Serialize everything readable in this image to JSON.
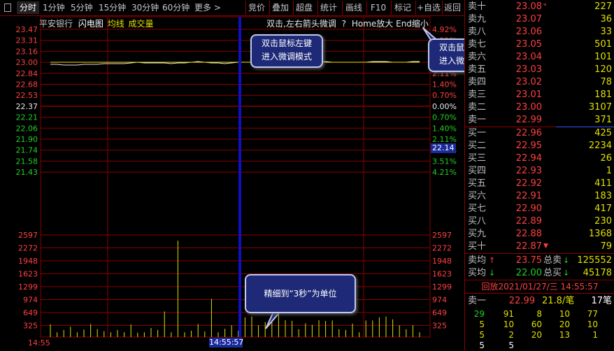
{
  "toolbar": {
    "items": [
      "分时",
      "1分钟",
      "5分钟",
      "15分钟",
      "30分钟",
      "60分钟",
      "更多 >",
      "竞价",
      "叠加",
      "超盘",
      "统计",
      "画线",
      "F10",
      "标记",
      "+自选",
      "返回"
    ]
  },
  "chart": {
    "stock_name": "平安银行",
    "mode_flash": "闪电图",
    "mode_avg": "均线",
    "mode_vol": "成交量",
    "hint": "双击,左右箭头微调",
    "hint_q": "?",
    "hint2": "Home放大 End缩小",
    "price_labels": [
      "23.47",
      "23.31",
      "23.16",
      "23.00",
      "22.84",
      "22.68",
      "22.53",
      "22.37",
      "22.21",
      "22.06",
      "21.90",
      "21.74",
      "21.58",
      "21.43"
    ],
    "pct_labels": [
      "4.92%",
      "4.21%",
      "3.51%",
      "2.81%",
      "2.11%",
      "1.40%",
      "0.70%",
      "0.00%",
      "0.70%",
      "1.40%",
      "2.11%",
      "2.81%",
      "3.51%",
      "4.21%"
    ],
    "vol_labels": [
      "2597",
      "2272",
      "1948",
      "1623",
      "1299",
      "974",
      "649",
      "325"
    ],
    "current_price_tag": "22.14",
    "time_start": "14:55",
    "time_cursor": "14:55:57",
    "tips": {
      "tip1_line1": "双击鼠标左键",
      "tip1_line2": "进入微调模式",
      "tip2_line1": "双击鼠标左键",
      "tip2_line2": "进入微调模式",
      "tip3": "精细到“3秒”为单位"
    },
    "colors": {
      "grid": "#8a0000",
      "price_line": "#e8e8e8",
      "avg_line": "#e0e000",
      "cursor": "#1010c0"
    }
  },
  "chart_data": {
    "type": "line",
    "series": [
      {
        "values": [
          22.97,
          22.97,
          22.96,
          22.96,
          22.96,
          22.97,
          22.97,
          22.97,
          22.98,
          22.98,
          22.98,
          22.98,
          22.99,
          23.0,
          22.99,
          22.99,
          22.99,
          22.99,
          22.98,
          22.99,
          22.99,
          23.0,
          23.01,
          23.0,
          22.99,
          22.99,
          22.98,
          22.99,
          23.0,
          23.0,
          23.0,
          23.01,
          23.01,
          23.0,
          23.0,
          23.01,
          23.01,
          23.0,
          23.0,
          23.0,
          23.01,
          23.01,
          23.0,
          23.0,
          23.0,
          23.0,
          23.0,
          23.0,
          23.01,
          23.01,
          23.01,
          23.0,
          23.0,
          23.0,
          23.01,
          23.01
        ]
      },
      {
        "values": [
          23.0,
          23.0,
          23.0,
          23.0,
          23.0,
          23.0,
          23.0,
          23.0,
          23.0,
          23.0,
          23.0,
          23.0,
          23.0,
          23.0,
          23.0,
          23.0,
          23.0,
          23.0,
          23.0,
          23.0,
          23.0,
          23.0,
          23.0,
          23.0,
          23.0,
          23.0,
          23.0,
          23.0,
          23.0,
          23.0,
          23.0,
          23.0,
          23.0,
          23.0,
          23.0,
          23.0,
          23.0,
          23.0,
          23.0,
          23.0,
          23.0,
          23.0,
          23.0,
          23.0,
          23.0,
          23.0,
          23.0,
          23.0,
          23.0,
          23.0,
          23.0,
          23.0,
          23.0,
          23.0,
          23.0,
          23.0
        ]
      }
    ],
    "volume_values": [
      325,
      120,
      180,
      260,
      120,
      190,
      330,
      200,
      150,
      120,
      180,
      120,
      320,
      110,
      120,
      230,
      180,
      650,
      120,
      2450,
      120,
      160,
      330,
      140,
      970,
      120,
      210,
      300,
      160,
      500,
      520,
      300,
      380,
      560,
      600,
      430,
      410,
      200,
      350,
      310,
      430,
      410,
      420,
      200,
      180,
      340,
      120,
      420,
      420,
      500,
      520,
      450,
      300,
      200,
      300,
      120
    ],
    "ylim": [
      21.27,
      23.47
    ],
    "vol_ylim": [
      0,
      2597
    ]
  },
  "panel": {
    "sell": [
      {
        "label": "卖十",
        "price": "23.08",
        "vol": "227",
        "mark": "*"
      },
      {
        "label": "卖九",
        "price": "23.07",
        "vol": "36",
        "mark": ""
      },
      {
        "label": "卖八",
        "price": "23.06",
        "vol": "33",
        "mark": ""
      },
      {
        "label": "卖七",
        "price": "23.05",
        "vol": "501",
        "mark": ""
      },
      {
        "label": "卖六",
        "price": "23.04",
        "vol": "101",
        "mark": ""
      },
      {
        "label": "卖五",
        "price": "23.03",
        "vol": "120",
        "mark": ""
      },
      {
        "label": "卖四",
        "price": "23.02",
        "vol": "78",
        "mark": ""
      },
      {
        "label": "卖三",
        "price": "23.01",
        "vol": "181",
        "mark": ""
      },
      {
        "label": "卖二",
        "price": "23.00",
        "vol": "3107",
        "mark": ""
      },
      {
        "label": "卖一",
        "price": "22.99",
        "vol": "371",
        "mark": ""
      }
    ],
    "buy": [
      {
        "label": "买一",
        "price": "22.96",
        "vol": "425",
        "mark": ""
      },
      {
        "label": "买二",
        "price": "22.95",
        "vol": "2234",
        "mark": ""
      },
      {
        "label": "买三",
        "price": "22.94",
        "vol": "26",
        "mark": ""
      },
      {
        "label": "买四",
        "price": "22.93",
        "vol": "1",
        "mark": ""
      },
      {
        "label": "买五",
        "price": "22.92",
        "vol": "411",
        "mark": ""
      },
      {
        "label": "买六",
        "price": "22.91",
        "vol": "183",
        "mark": ""
      },
      {
        "label": "买七",
        "price": "22.90",
        "vol": "417",
        "mark": ""
      },
      {
        "label": "买八",
        "price": "22.89",
        "vol": "230",
        "mark": ""
      },
      {
        "label": "买九",
        "price": "22.88",
        "vol": "1368",
        "mark": ""
      },
      {
        "label": "买十",
        "price": "22.87",
        "vol": "79",
        "mark": "▼"
      }
    ],
    "avg_sell_label": "卖均",
    "avg_sell_price": "23.75",
    "total_sell_label": "总卖",
    "total_sell": "125552",
    "avg_buy_label": "买均",
    "avg_buy_price": "22.00",
    "total_buy_label": "总买",
    "total_buy": "45178",
    "replay": "回放2021/01/27/三 14:55:57",
    "last_label": "卖一",
    "last_price": "22.99",
    "last_vol": "21.8/笔",
    "last_count": "17笔",
    "grid": [
      [
        "29",
        "91",
        "8",
        "10",
        "77"
      ],
      [
        "5",
        "10",
        "60",
        "20",
        "10"
      ],
      [
        "5",
        "2",
        "20",
        "13",
        "1"
      ],
      [
        "5",
        "5",
        "",
        "",
        ""
      ]
    ]
  }
}
